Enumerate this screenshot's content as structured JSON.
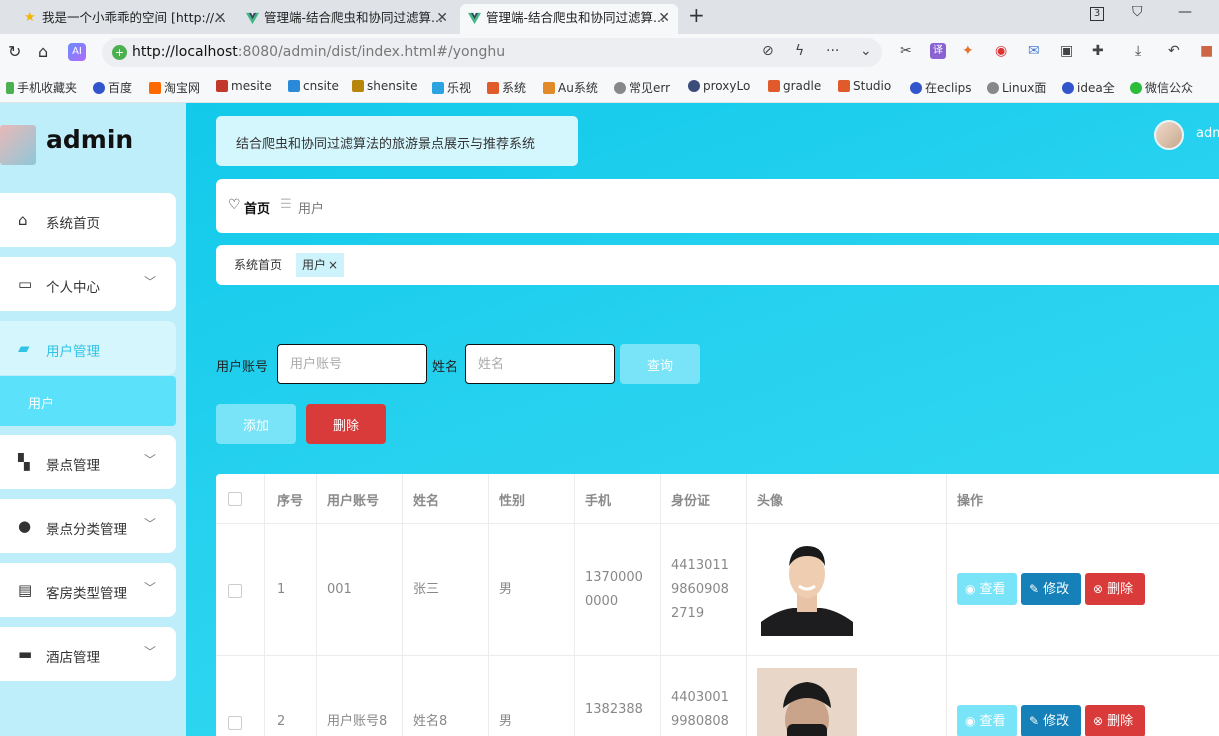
{
  "browser": {
    "tabs": [
      {
        "title": "我是一个小乖乖的空间 [http://..."
      },
      {
        "title": "管理端-结合爬虫和协同过滤算..."
      },
      {
        "title": "管理端-结合爬虫和协同过滤算..."
      }
    ],
    "new_tab": "+",
    "tab_count_badge": "3",
    "url_host": "http://localhost",
    "url_rest": ":8080/admin/dist/index.html#/yonghu",
    "bookmarks": [
      "手机收藏夹",
      "百度",
      "淘宝网",
      "mesite",
      "cnsite",
      "shensite",
      "乐视",
      "系统",
      "Au系统",
      "常见err",
      "proxyLo",
      "gradle",
      "Studio",
      "在eclips",
      "Linux面",
      "idea全",
      "微信公众"
    ]
  },
  "app": {
    "title": "admin",
    "system_title": "结合爬虫和协同过滤算法的旅游景点展示与推荐系统",
    "username": "admin"
  },
  "sidebar": {
    "items": [
      {
        "label": "系统首页",
        "icon": "home-icon"
      },
      {
        "label": "个人中心",
        "icon": "profile-icon"
      },
      {
        "label": "用户管理",
        "icon": "users-icon"
      },
      {
        "label": "景点管理",
        "icon": "grid-icon"
      },
      {
        "label": "景点分类管理",
        "icon": "person-icon"
      },
      {
        "label": "客房类型管理",
        "icon": "clipboard-icon"
      },
      {
        "label": "酒店管理",
        "icon": "monitor-icon"
      }
    ],
    "sub_active": "用户"
  },
  "breadcrumb": {
    "home": "首页",
    "separator": "☰",
    "current": "用户"
  },
  "tags": [
    {
      "label": "系统首页"
    },
    {
      "label": "用户",
      "close": "×"
    }
  ],
  "search": {
    "account_label": "用户账号",
    "account_placeholder": "用户账号",
    "name_label": "姓名",
    "name_placeholder": "姓名",
    "query_button": "查询"
  },
  "actions": {
    "add": "添加",
    "delete": "删除"
  },
  "table": {
    "headers": [
      "序号",
      "用户账号",
      "姓名",
      "性别",
      "手机",
      "身份证",
      "头像",
      "操作"
    ],
    "rows": [
      {
        "index": "1",
        "account": "001",
        "name": "张三",
        "gender": "男",
        "phone_l1": "1370000",
        "phone_l2": "0000",
        "id_l1": "4413011",
        "id_l2": "9860908",
        "id_l3": "2719"
      },
      {
        "index": "2",
        "account": "用户账号8",
        "name": "姓名8",
        "gender": "男",
        "phone_l1": "1382388",
        "phone_l2": "",
        "id_l1": "4403001",
        "id_l2": "9980808",
        "id_l3": ""
      }
    ],
    "row_actions": {
      "view": "查看",
      "edit": "修改",
      "delete": "删除"
    }
  },
  "colors": {
    "accent": "#31c3e6",
    "danger": "#d93a3a",
    "edit": "#1581b8",
    "light_button": "#79e3f7"
  }
}
